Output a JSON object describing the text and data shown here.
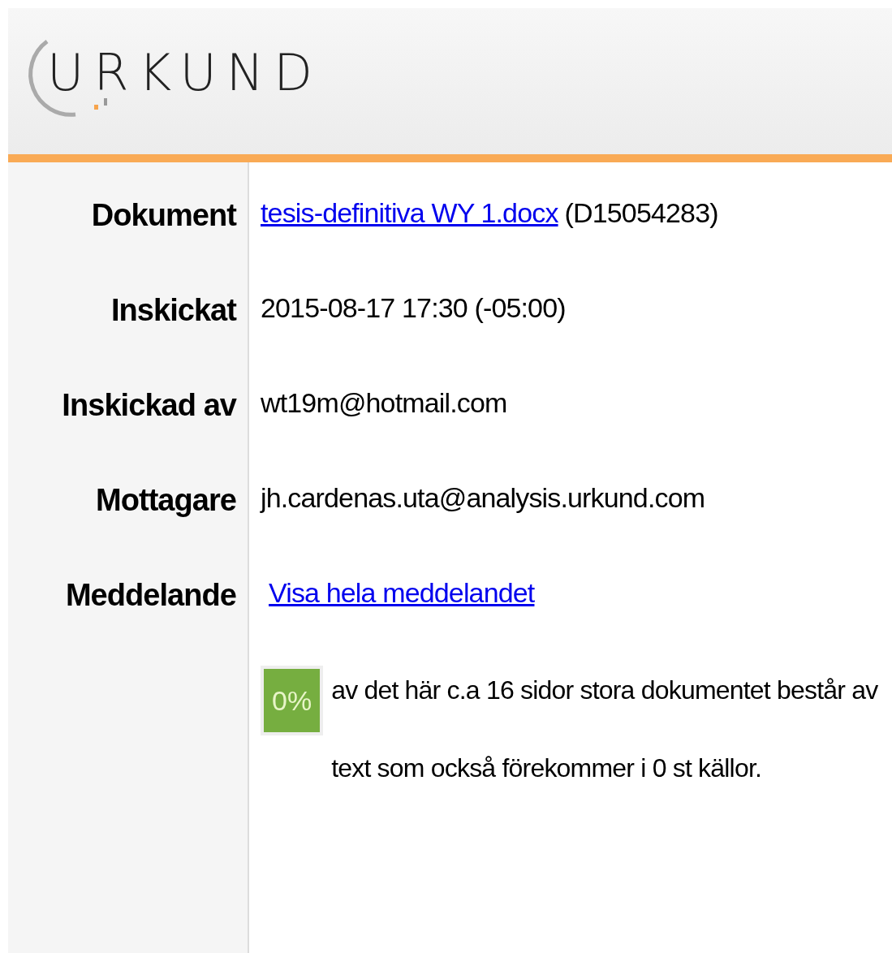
{
  "logo": {
    "text": "URKUND"
  },
  "fields": [
    {
      "label": "Dokument",
      "kind": "link",
      "link": "tesis-definitiva WY 1.docx",
      "text": "(D15054283)"
    },
    {
      "label": "Inskickat",
      "kind": "text",
      "text": "2015-08-17 17:30 (-05:00)"
    },
    {
      "label": "Inskickad av",
      "kind": "text",
      "text": "wt19m@hotmail.com"
    },
    {
      "label": "Mottagare",
      "kind": "text",
      "text": "jh.cardenas.uta@analysis.urkund.com"
    },
    {
      "label": "Meddelande",
      "kind": "link",
      "link": "Visa hela meddelandet"
    }
  ],
  "summary": {
    "percent": "0%",
    "text": "av det här c.a 16 sidor stora dokumentet består av text som också förekommer i 0 st källor."
  }
}
